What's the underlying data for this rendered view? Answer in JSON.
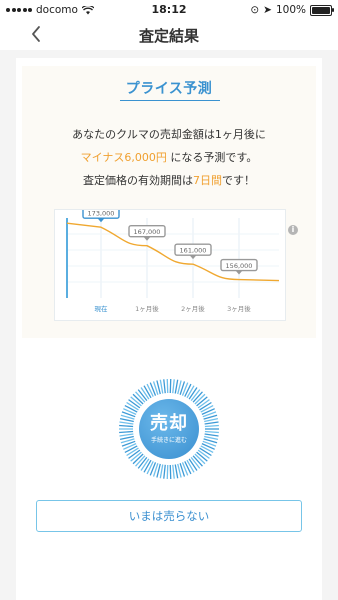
{
  "status_bar": {
    "carrier": "docomo",
    "time": "18:12",
    "battery": "100%"
  },
  "nav": {
    "title": "査定結果"
  },
  "forecast": {
    "title": "プライス予測",
    "line1": "あなたのクルマの売却金額は1ヶ月後に",
    "line2_highlight": "マイナス6,000円",
    "line2_rest": " になる予測です。",
    "line3_pre": "査定価格の有効期間は",
    "line3_highlight": "7日間",
    "line3_post": "です！"
  },
  "chart_data": {
    "type": "line",
    "categories": [
      "現在",
      "1ヶ月後",
      "2ヶ月後",
      "3ヶ月後"
    ],
    "values": [
      173000,
      167000,
      161000,
      156000
    ],
    "labels": [
      "173,000",
      "167,000",
      "161,000",
      "156,000"
    ],
    "title": "",
    "xlabel": "",
    "ylabel": "",
    "ylim": [
      150000,
      176000
    ],
    "grid": true,
    "line_color": "#f0a830",
    "label_border_colors": [
      "#3a92d0",
      "#999999",
      "#999999",
      "#999999"
    ]
  },
  "sell_button": {
    "label": "売却",
    "sub_label": "手続きに進む"
  },
  "not_now_button": {
    "label": "いまは売らない"
  },
  "colors": {
    "accent_blue": "#3a92d0",
    "highlight_orange": "#f0a030"
  }
}
